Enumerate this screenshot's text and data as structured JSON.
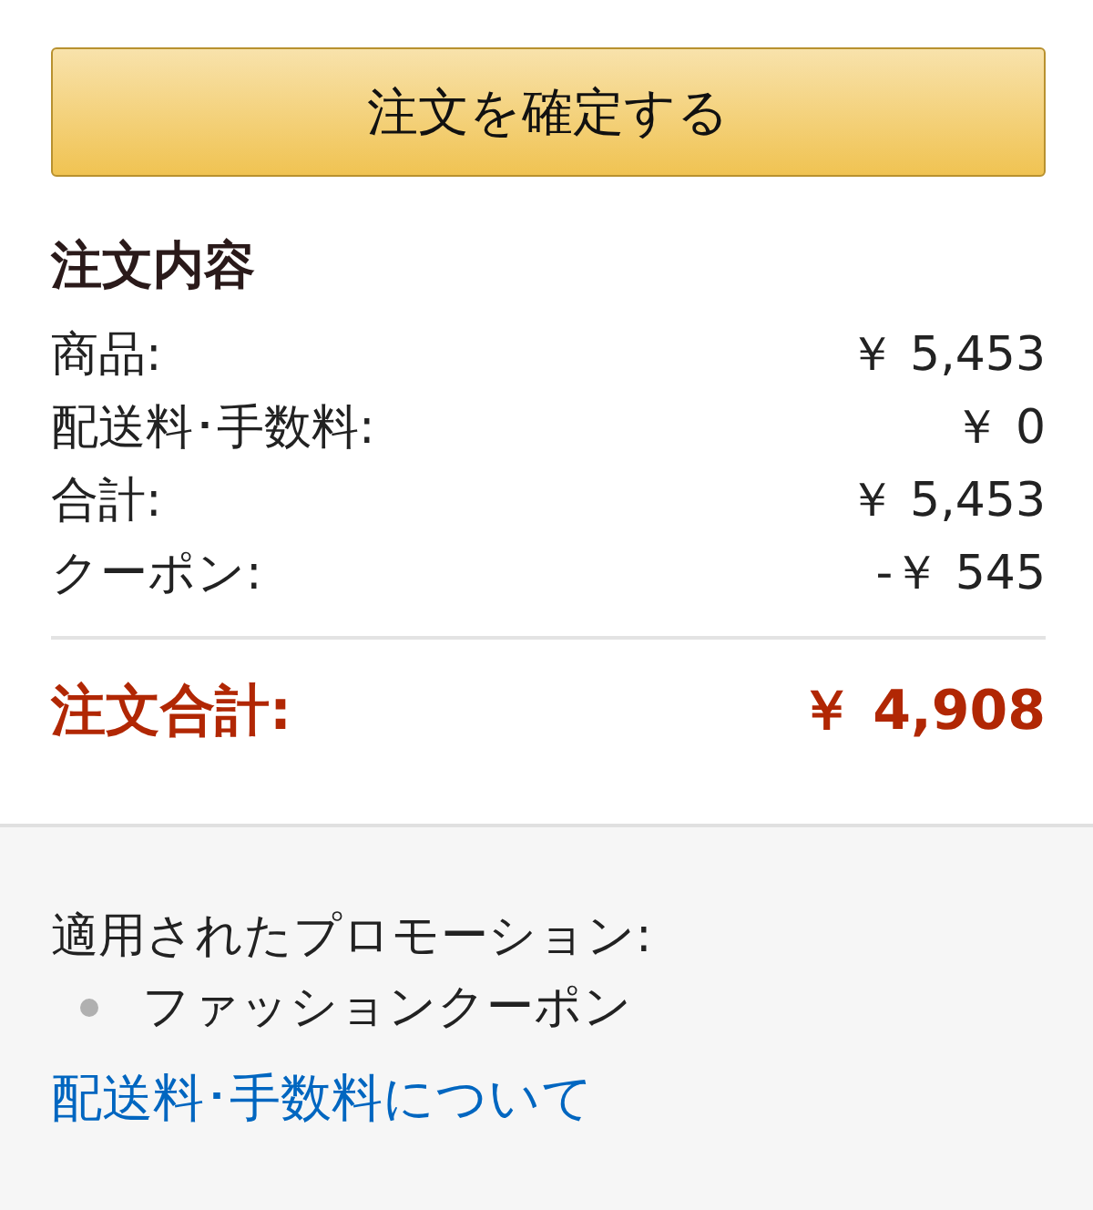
{
  "place_order_button": {
    "label": "注文を確定する"
  },
  "order_summary": {
    "title": "注文内容",
    "lines": [
      {
        "label": "商品:",
        "amount": "￥ 5,453"
      },
      {
        "label": "配送料･手数料:",
        "amount": "￥ 0"
      },
      {
        "label": "合計:",
        "amount": "￥ 5,453"
      },
      {
        "label": "クーポン:",
        "amount": "-￥ 545"
      }
    ],
    "total": {
      "label": "注文合計:",
      "amount": "￥ 4,908"
    }
  },
  "promotions": {
    "title": "適用されたプロモーション:",
    "items": [
      "ファッションクーポン"
    ]
  },
  "shipping_link": {
    "label": "配送料･手数料について"
  }
}
